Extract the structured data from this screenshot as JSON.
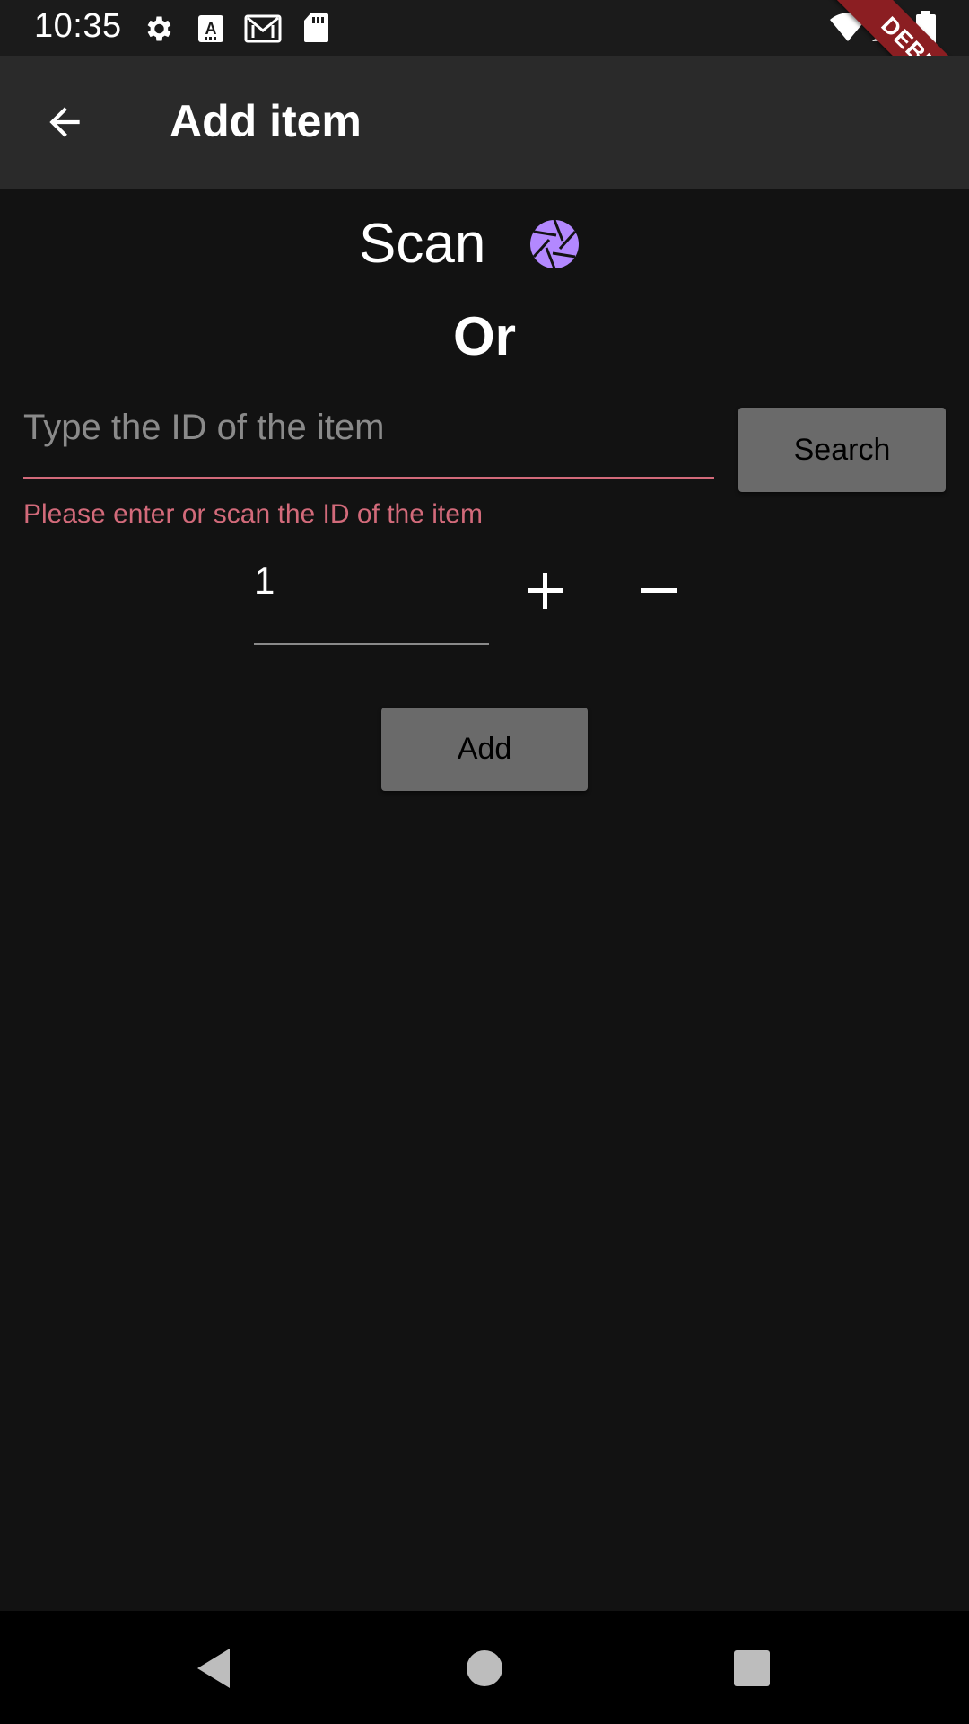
{
  "status_bar": {
    "time": "10:35",
    "left_icons": [
      "gear-icon",
      "a-font-icon",
      "gmail-icon",
      "sd-card-icon"
    ],
    "right_icons": [
      "wifi-icon",
      "cell-signal-icon",
      "battery-icon"
    ]
  },
  "debug_banner": "DEBUG",
  "app_bar": {
    "title": "Add item",
    "back_icon": "arrow-back-icon"
  },
  "scan": {
    "label": "Scan",
    "icon": "camera-aperture-icon",
    "icon_color": "#b388ff"
  },
  "or_label": "Or",
  "id_field": {
    "placeholder": "Type the ID of the item",
    "value": "",
    "error": "Please enter or scan the ID of the item",
    "error_color": "#d26a7a"
  },
  "search_button": "Search",
  "quantity": {
    "value": "1",
    "increment_icon": "plus-icon",
    "decrement_icon": "minus-icon"
  },
  "add_button": "Add",
  "nav_bar": {
    "icons": [
      "nav-back-icon",
      "nav-home-icon",
      "nav-recents-icon"
    ]
  }
}
